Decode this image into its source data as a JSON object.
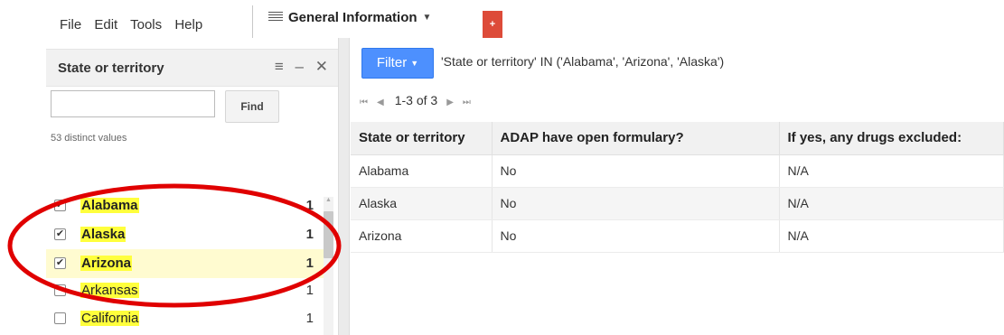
{
  "menu": {
    "items": [
      "File",
      "Edit",
      "Tools",
      "Help"
    ]
  },
  "tab": {
    "title": "General Information",
    "add_label": "+"
  },
  "filter_panel": {
    "title": "State or territory",
    "controls": [
      "≡",
      "–",
      "✕"
    ],
    "find_label": "Find",
    "search_value": "",
    "distinct_count": "53 distinct values",
    "values": [
      {
        "label": "Alabama",
        "count": "1",
        "checked": true
      },
      {
        "label": "Alaska",
        "count": "1",
        "checked": true
      },
      {
        "label": "Arizona",
        "count": "1",
        "checked": true
      },
      {
        "label": "Arkansas",
        "count": "1",
        "checked": false
      },
      {
        "label": "California",
        "count": "1",
        "checked": false
      }
    ]
  },
  "filter_bar": {
    "button_label": "Filter",
    "expression": "'State or territory' IN ('Alabama', 'Arizona', 'Alaska')"
  },
  "pager": {
    "range": "1-3 of 3"
  },
  "table": {
    "columns": [
      "State or territory",
      "ADAP have open formulary?",
      "If yes, any drugs excluded:"
    ],
    "rows": [
      [
        "Alabama",
        "No",
        "N/A"
      ],
      [
        "Alaska",
        "No",
        "N/A"
      ],
      [
        "Arizona",
        "No",
        "N/A"
      ]
    ]
  },
  "colors": {
    "accent": "#4d90fe",
    "highlight": "#ffff3c",
    "annotation": "#e00000",
    "add_tab": "#dd4b39"
  }
}
